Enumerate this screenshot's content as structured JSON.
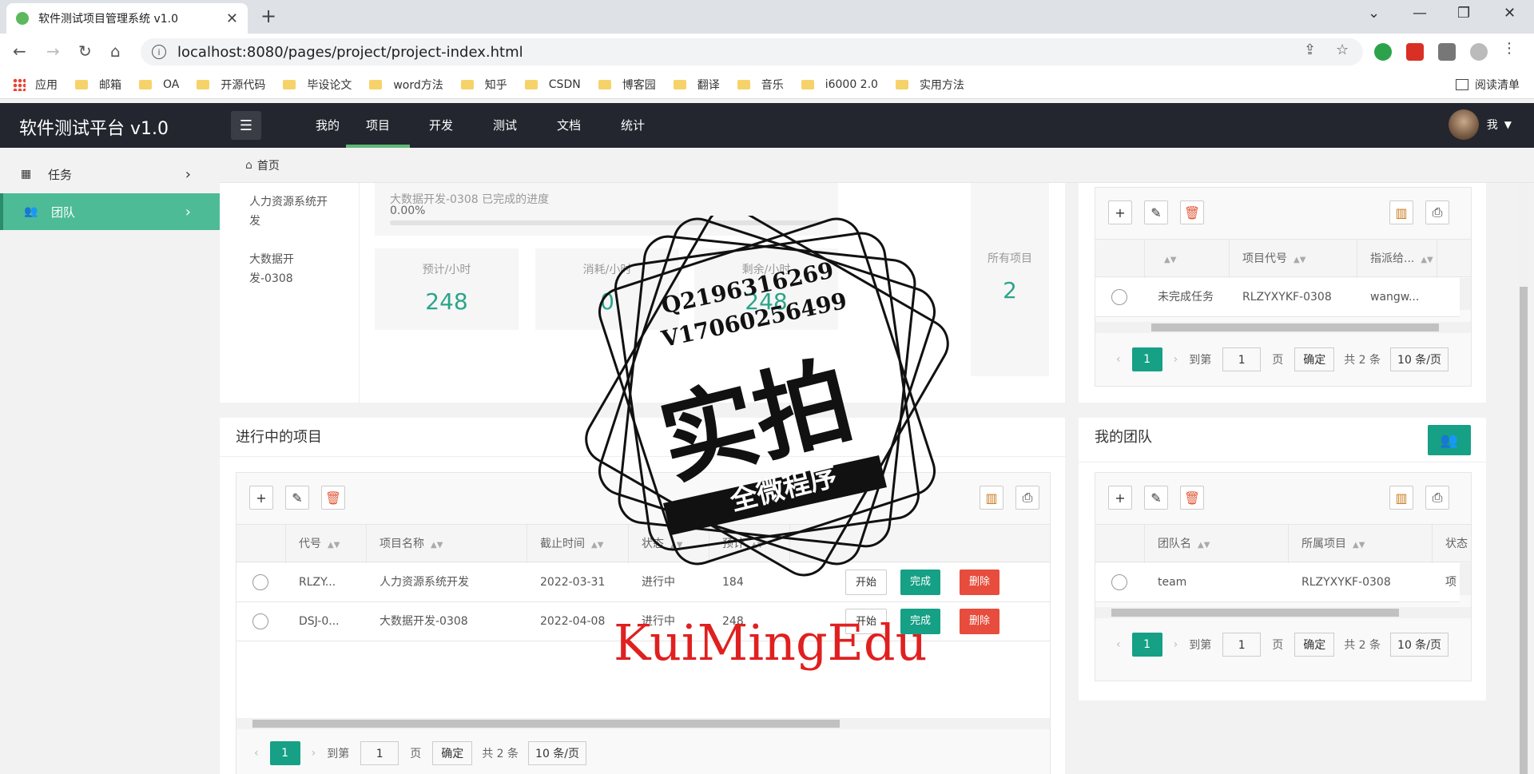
{
  "browser": {
    "tab_title": "软件测试项目管理系统 v1.0",
    "url": "localhost:8080/pages/project/project-index.html",
    "bookmarks": [
      "应用",
      "邮箱",
      "OA",
      "开源代码",
      "毕设论文",
      "word方法",
      "知乎",
      "CSDN",
      "博客园",
      "翻译",
      "音乐",
      "i6000 2.0",
      "实用方法"
    ],
    "reading_list": "阅读清单"
  },
  "header": {
    "brand": "软件测试平台 v1.0",
    "nav": [
      "我的",
      "项目",
      "开发",
      "测试",
      "文档",
      "统计"
    ],
    "active_nav": "项目",
    "user_label": "我"
  },
  "sidebar": {
    "items": [
      {
        "label": "任务",
        "icon": "grid-icon"
      },
      {
        "label": "团队",
        "icon": "users-icon",
        "active": true
      }
    ]
  },
  "breadcrumb": {
    "home": "首页"
  },
  "overview": {
    "projects": [
      "人力资源系统开发",
      "大数据开发-0308"
    ],
    "progress_text": "大数据开发-0308 已完成的进度",
    "progress_value": "0.00%",
    "progress_fraction": 0.0,
    "stats": [
      {
        "label": "预计/小时",
        "value": "248"
      },
      {
        "label": "消耗/小时",
        "value": "0"
      },
      {
        "label": "剩余/小时",
        "value": "248"
      }
    ],
    "all_projects_label": "所有项目",
    "all_projects_value": "2"
  },
  "task_panel": {
    "headers": [
      "",
      "项目代号",
      "指派给..."
    ],
    "rows": [
      {
        "task": "未完成任务",
        "code": "RLZYXYKF-0308",
        "assignee": "wangw..."
      }
    ],
    "pager": {
      "current": "1",
      "goto_label": "到第",
      "page_input": "1",
      "page_unit": "页",
      "confirm": "确定",
      "total": "共 2 条",
      "per_page": "10 条/页"
    }
  },
  "projects_panel": {
    "title": "进行中的项目",
    "headers": [
      "代号",
      "项目名称",
      "截止时间",
      "状态",
      "预计"
    ],
    "rows": [
      {
        "code": "RLZY...",
        "name": "人力资源系统开发",
        "deadline": "2022-03-31",
        "status": "进行中",
        "estimate": "184"
      },
      {
        "code": "DSJ-0...",
        "name": "大数据开发-0308",
        "deadline": "2022-04-08",
        "status": "进行中",
        "estimate": "248"
      }
    ],
    "actions": {
      "start": "开始",
      "finish": "完成",
      "delete": "删除"
    },
    "pager": {
      "current": "1",
      "goto_label": "到第",
      "page_input": "1",
      "page_unit": "页",
      "confirm": "确定",
      "total": "共 2 条",
      "per_page": "10 条/页"
    }
  },
  "team_panel": {
    "title": "我的团队",
    "headers": [
      "团队名",
      "所属项目",
      "状态"
    ],
    "rows": [
      {
        "name": "team",
        "project": "RLZYXYKF-0308",
        "status": "项"
      }
    ],
    "pager": {
      "current": "1",
      "goto_label": "到第",
      "page_input": "1",
      "page_unit": "页",
      "confirm": "确定",
      "total": "共 2 条",
      "per_page": "10 条/页"
    }
  },
  "watermark": {
    "line1": "Q2196316269",
    "line2": "V17060256499",
    "big": "实拍",
    "banner": "全微程序",
    "footer": "KuiMingEdu"
  },
  "colors": {
    "accent": "#16a085",
    "sidebar_active": "#4dbb96",
    "header_bg": "#23262e",
    "danger": "#e74c3c"
  }
}
